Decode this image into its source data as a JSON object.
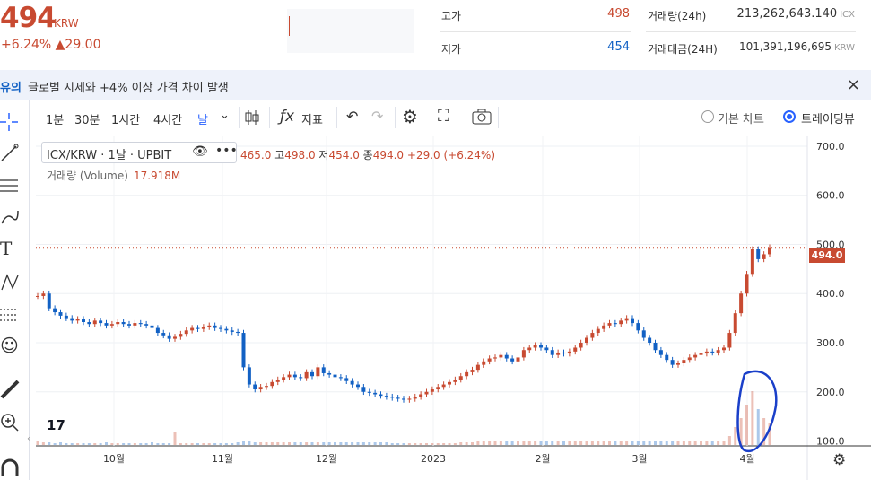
{
  "header": {
    "price": "494",
    "currency": "KRW",
    "change": "+6.24% ▲29.00",
    "stats": [
      {
        "label": "고가",
        "value": "498",
        "tone": "up"
      },
      {
        "label": "저가",
        "value": "454",
        "tone": "down"
      },
      {
        "label": "거래량(24h)",
        "value": "213,262,643.140",
        "unit": "ICX"
      },
      {
        "label": "거래대금(24H)",
        "value": "101,391,196,695",
        "unit": "KRW"
      }
    ]
  },
  "banner": {
    "tag": "유의",
    "text": "글로벌 시세와 +4% 이상 가격 차이 발생",
    "close_icon": "×"
  },
  "toolbar": {
    "intervals": [
      "1분",
      "30분",
      "1시간",
      "4시간",
      "날"
    ],
    "active_interval": "날",
    "indicators_label": "지표",
    "radio_basic": "기본 차트",
    "radio_trading": "트레이딩뷰"
  },
  "legend": {
    "symbol": "ICX/KRW · 1날 · UPBIT",
    "ohlc": {
      "open_key": "",
      "open": "465.0",
      "high_key": "고",
      "high": "498.0",
      "low_key": "저",
      "low": "454.0",
      "close_key": "종",
      "close": "494.0",
      "change": "+29.0 (+6.24%)"
    },
    "volume_label": "거래량 (Volume)",
    "volume_value": "17.918M"
  },
  "price_tag": "494.0",
  "tv_logo": "17",
  "chart_data": {
    "type": "candlestick",
    "x_labels": [
      "10월",
      "11월",
      "12월",
      "2023",
      "2월",
      "3월",
      "4월"
    ],
    "y_ticks": [
      "700.0",
      "600.0",
      "500.0",
      "400.0",
      "300.0",
      "200.0",
      "100.0"
    ],
    "ylim": [
      90,
      720
    ],
    "grid": true,
    "last_price": 494,
    "series_close": [
      395,
      400,
      370,
      362,
      355,
      350,
      345,
      348,
      342,
      338,
      345,
      340,
      335,
      338,
      342,
      338,
      335,
      340,
      338,
      335,
      330,
      320,
      315,
      308,
      312,
      318,
      325,
      330,
      328,
      332,
      335,
      330,
      328,
      325,
      322,
      320,
      250,
      215,
      205,
      210,
      212,
      220,
      225,
      230,
      235,
      230,
      228,
      240,
      232,
      250,
      238,
      235,
      230,
      228,
      222,
      215,
      210,
      200,
      198,
      195,
      192,
      190,
      188,
      186,
      184,
      186,
      190,
      195,
      200,
      205,
      210,
      215,
      220,
      225,
      232,
      240,
      245,
      255,
      262,
      268,
      270,
      275,
      268,
      262,
      270,
      285,
      290,
      295,
      290,
      285,
      275,
      280,
      278,
      282,
      290,
      300,
      310,
      320,
      328,
      335,
      340,
      338,
      345,
      350,
      340,
      325,
      310,
      300,
      285,
      275,
      265,
      255,
      258,
      265,
      270,
      275,
      278,
      282,
      280,
      285,
      290,
      320,
      360,
      400,
      440,
      490,
      470,
      480,
      494
    ],
    "volume": [
      4,
      3,
      3,
      2,
      3,
      2,
      2,
      2,
      2,
      2,
      2,
      2,
      3,
      2,
      2,
      2,
      2,
      2,
      2,
      2,
      3,
      2,
      2,
      2,
      15,
      2,
      2,
      2,
      2,
      2,
      2,
      2,
      2,
      2,
      2,
      3,
      5,
      4,
      3,
      3,
      3,
      3,
      3,
      3,
      3,
      3,
      3,
      3,
      3,
      3,
      3,
      3,
      3,
      3,
      3,
      3,
      3,
      3,
      3,
      3,
      3,
      3,
      2,
      2,
      2,
      2,
      2,
      2,
      2,
      2,
      2,
      2,
      2,
      2,
      3,
      3,
      3,
      4,
      4,
      4,
      4,
      5,
      5,
      5,
      5,
      5,
      5,
      5,
      5,
      5,
      5,
      5,
      5,
      5,
      5,
      5,
      5,
      5,
      5,
      5,
      5,
      5,
      5,
      5,
      5,
      5,
      4,
      4,
      4,
      4,
      4,
      4,
      4,
      4,
      4,
      4,
      4,
      4,
      4,
      4,
      4,
      10,
      20,
      30,
      45,
      60,
      40,
      30,
      25
    ],
    "annotation": "blue hand-drawn circle around recent volume spike"
  }
}
